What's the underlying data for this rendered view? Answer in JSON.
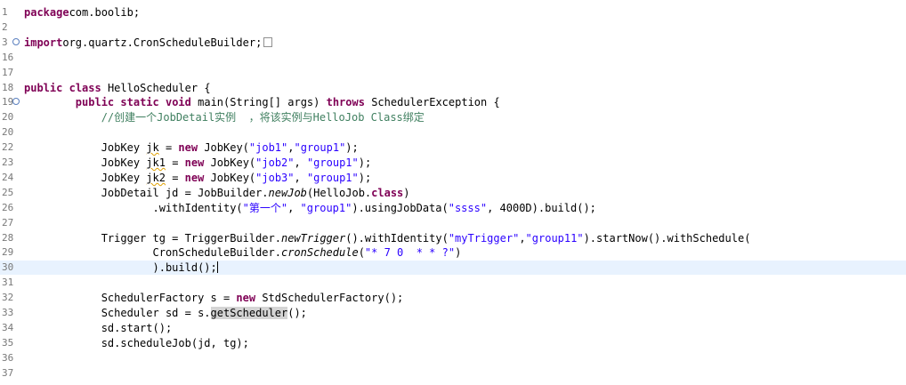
{
  "editor": {
    "lines": [
      {
        "num": "1",
        "segments": [
          [
            "kw",
            "package"
          ],
          [
            "",
            "com.boolib;"
          ]
        ]
      },
      {
        "num": "2",
        "segments": []
      },
      {
        "num": "3",
        "fold": "+",
        "segments": [
          [
            "kw",
            "import"
          ],
          [
            "",
            "org.quartz.CronScheduleBuilder;"
          ]
        ],
        "folded_box": true
      },
      {
        "num": "16",
        "segments": []
      },
      {
        "num": "17",
        "segments": []
      },
      {
        "num": "18",
        "segments": [
          [
            "kw",
            "public"
          ],
          [
            "",
            " "
          ],
          [
            "kw",
            "class"
          ],
          [
            "",
            " HelloScheduler {"
          ]
        ]
      },
      {
        "num": "19",
        "fold": "-",
        "segments": [
          [
            "",
            "        "
          ],
          [
            "kw",
            "public"
          ],
          [
            "",
            " "
          ],
          [
            "kw",
            "static"
          ],
          [
            "",
            " "
          ],
          [
            "kw",
            "void"
          ],
          [
            "",
            " main(String[] args) "
          ],
          [
            "kw",
            "throws"
          ],
          [
            "",
            " SchedulerException {"
          ]
        ]
      },
      {
        "num": "20",
        "segments": [
          [
            "",
            "            "
          ],
          [
            "cmt",
            "//创建一个JobDetail实例  ，将该实例与HelloJob Class绑定"
          ]
        ]
      },
      {
        "num": "20",
        "segments": []
      },
      {
        "num": "22",
        "segments": [
          [
            "",
            "            JobKey "
          ],
          [
            "warn",
            "jk"
          ],
          [
            "",
            " = "
          ],
          [
            "kw",
            "new"
          ],
          [
            "",
            " JobKey("
          ],
          [
            "str",
            "\"job1\""
          ],
          [
            "",
            ","
          ],
          [
            "str",
            "\"group1\""
          ],
          [
            "",
            ");"
          ]
        ]
      },
      {
        "num": "23",
        "segments": [
          [
            "",
            "            JobKey "
          ],
          [
            "warn",
            "jk1"
          ],
          [
            "",
            " = "
          ],
          [
            "kw",
            "new"
          ],
          [
            "",
            " JobKey("
          ],
          [
            "str",
            "\"job2\""
          ],
          [
            "",
            ", "
          ],
          [
            "str",
            "\"group1\""
          ],
          [
            "",
            ");"
          ]
        ]
      },
      {
        "num": "24",
        "segments": [
          [
            "",
            "            JobKey "
          ],
          [
            "warn",
            "jk2"
          ],
          [
            "",
            " = "
          ],
          [
            "kw",
            "new"
          ],
          [
            "",
            " JobKey("
          ],
          [
            "str",
            "\"job3\""
          ],
          [
            "",
            ", "
          ],
          [
            "str",
            "\"group1\""
          ],
          [
            "",
            ");"
          ]
        ]
      },
      {
        "num": "25",
        "segments": [
          [
            "",
            "            JobDetail jd = JobBuilder."
          ],
          [
            "ital",
            "newJob"
          ],
          [
            "",
            "(HelloJob."
          ],
          [
            "kw",
            "class"
          ],
          [
            "",
            ")"
          ]
        ]
      },
      {
        "num": "26",
        "segments": [
          [
            "",
            "                    .withIdentity("
          ],
          [
            "str",
            "\"第一个\""
          ],
          [
            "",
            ", "
          ],
          [
            "str",
            "\"group1\""
          ],
          [
            "",
            ").usingJobData("
          ],
          [
            "str",
            "\"ssss\""
          ],
          [
            "",
            ", 4000D).build();"
          ]
        ]
      },
      {
        "num": "27",
        "segments": []
      },
      {
        "num": "28",
        "segments": [
          [
            "",
            "            Trigger tg = TriggerBuilder."
          ],
          [
            "ital",
            "newTrigger"
          ],
          [
            "",
            "().withIdentity("
          ],
          [
            "str",
            "\"myTrigger\""
          ],
          [
            "",
            ","
          ],
          [
            "str",
            "\"group11\""
          ],
          [
            "",
            ").startNow().withSchedule("
          ]
        ]
      },
      {
        "num": "29",
        "segments": [
          [
            "",
            "                    CronScheduleBuilder."
          ],
          [
            "ital",
            "cronSchedule"
          ],
          [
            "",
            "("
          ],
          [
            "str",
            "\"* 7 0  * * ?\""
          ],
          [
            "",
            ")"
          ]
        ]
      },
      {
        "num": "30",
        "current": true,
        "segments": [
          [
            "",
            "                    ).build();"
          ]
        ],
        "caret": true
      },
      {
        "num": "31",
        "segments": []
      },
      {
        "num": "32",
        "segments": [
          [
            "",
            "            SchedulerFactory s = "
          ],
          [
            "kw",
            "new"
          ],
          [
            "",
            " StdSchedulerFactory();"
          ]
        ]
      },
      {
        "num": "33",
        "segments": [
          [
            "",
            "            Scheduler sd = s."
          ],
          [
            "hl",
            "getScheduler"
          ],
          [
            "",
            "();"
          ]
        ]
      },
      {
        "num": "34",
        "segments": [
          [
            "",
            "            sd.start();"
          ]
        ]
      },
      {
        "num": "35",
        "segments": [
          [
            "",
            "            sd.scheduleJob(jd, tg);"
          ]
        ]
      },
      {
        "num": "36",
        "segments": []
      },
      {
        "num": "37",
        "segments": []
      }
    ]
  }
}
